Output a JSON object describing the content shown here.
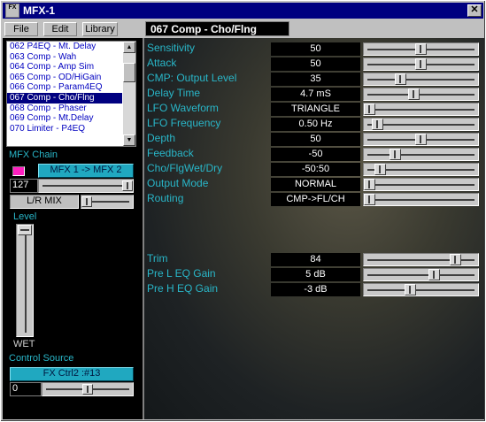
{
  "window": {
    "title": "MFX-1",
    "icon_text": "FX",
    "close_label": "✕"
  },
  "menu": [
    {
      "label": "File"
    },
    {
      "label": "Edit"
    },
    {
      "label": "Library"
    }
  ],
  "header": {
    "preset_title": "067 Comp - Cho/Flng"
  },
  "library_list": {
    "items": [
      "062 P4EQ - Mt. Delay",
      "063 Comp - Wah",
      "064 Comp - Amp Sim",
      "065 Comp - OD/HiGain",
      "066 Comp - Param4EQ",
      "067 Comp - Cho/Flng",
      "068 Comp - Phaser",
      "069 Comp - Mt.Delay",
      "070 Limiter - P4EQ"
    ],
    "selected_index": 5
  },
  "mfx_chain": {
    "label": "MFX Chain",
    "routing_button": "MFX 1 -> MFX 2",
    "value": "127",
    "slider_fraction": 1.0,
    "mix_label": "L/R MIX",
    "mix_fraction": 0.0
  },
  "level": {
    "label": "Level",
    "bottom_label": "WET",
    "fraction": 1.0
  },
  "control_source": {
    "label": "Control Source",
    "button": "FX Ctrl2 :#13",
    "value": "0",
    "slider_fraction": 0.5
  },
  "params": [
    {
      "name": "Sensitivity",
      "value": "50",
      "fraction": 0.5
    },
    {
      "name": "Attack",
      "value": "50",
      "fraction": 0.5
    },
    {
      "name": "CMP: Output Level",
      "value": "35",
      "fraction": 0.3
    },
    {
      "name": "Delay Time",
      "value": "4.7 mS",
      "fraction": 0.43
    },
    {
      "name": "LFO Waveform",
      "value": "TRIANGLE",
      "fraction": 0.0
    },
    {
      "name": "LFO Frequency",
      "value": "0.50 Hz",
      "fraction": 0.08
    },
    {
      "name": "Depth",
      "value": "50",
      "fraction": 0.5
    },
    {
      "name": "Feedback",
      "value": "-50",
      "fraction": 0.25
    },
    {
      "name": "Cho/FlgWet/Dry",
      "value": "-50:50",
      "fraction": 0.1
    },
    {
      "name": "Output Mode",
      "value": "NORMAL",
      "fraction": 0.0
    },
    {
      "name": "Routing",
      "value": "CMP->FL/CH",
      "fraction": 0.0
    }
  ],
  "params2": [
    {
      "name": "Trim",
      "value": "84",
      "fraction": 0.84
    },
    {
      "name": "Pre L EQ Gain",
      "value": "5 dB",
      "fraction": 0.63
    },
    {
      "name": "Pre H EQ Gain",
      "value": "-3 dB",
      "fraction": 0.4
    }
  ],
  "colors": {
    "param_label": "#29b6c8",
    "title_bar": "#000080",
    "selected_row": "#000080",
    "chain_button": "#20a8c0",
    "led": "#ff20c0"
  }
}
